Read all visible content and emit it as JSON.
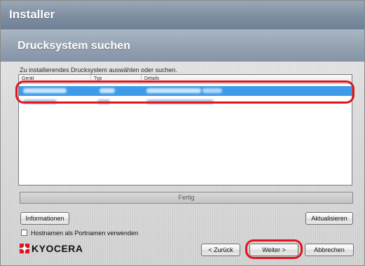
{
  "window": {
    "title": "Installer"
  },
  "page": {
    "heading": "Drucksystem suchen",
    "instruction": "Zu installierendes Drucksystem auswählen oder suchen."
  },
  "device_list": {
    "columns": [
      "Gerät",
      "Typ",
      "Details"
    ],
    "rows": [
      {
        "selected": true
      },
      {
        "selected": false
      }
    ],
    "selection_color": "#3d9be9"
  },
  "progress": {
    "status_text": "Fertig"
  },
  "buttons": {
    "info": "Informationen",
    "refresh": "Aktualisieren",
    "back": "< Zurück",
    "next": "Weiter >",
    "cancel": "Abbrechen"
  },
  "options": {
    "hostname_checkbox_label": "Hostnamen als Portnamen verwenden",
    "hostname_checked": false
  },
  "brand": {
    "logo_text": "KYOCERA",
    "logo_color": "#e0141d"
  },
  "annotation": {
    "highlight_color": "#e0141d"
  }
}
